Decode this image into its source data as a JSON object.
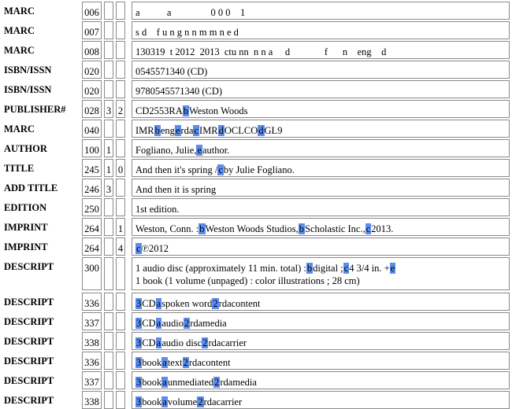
{
  "records": [
    {
      "label": "MARC",
      "tag": "006",
      "ind1": "",
      "ind2": "",
      "lines": [
        [
          "a           a                0 0 0    1"
        ]
      ]
    },
    {
      "label": "MARC",
      "tag": "007",
      "ind1": "",
      "ind2": "",
      "lines": [
        [
          "s d    f u n g n n m m n e d"
        ]
      ]
    },
    {
      "label": "MARC",
      "tag": "008",
      "ind1": "",
      "ind2": "",
      "lines": [
        [
          "130319  t 2012  2013  ctu nn  n n a     d              f      n    eng    d"
        ]
      ]
    },
    {
      "label": "ISBN/ISSN",
      "tag": "020",
      "ind1": "",
      "ind2": "",
      "lines": [
        [
          "0545571340 (CD)"
        ]
      ]
    },
    {
      "label": "ISBN/ISSN",
      "tag": "020",
      "ind1": "",
      "ind2": "",
      "lines": [
        [
          "9780545571340 (CD)"
        ]
      ]
    },
    {
      "label": "PUBLISHER#",
      "tag": "028",
      "ind1": "3",
      "ind2": "2",
      "lines": [
        [
          "CD2553RA",
          {
            "s": "b"
          },
          "Weston Woods"
        ]
      ]
    },
    {
      "label": "MARC",
      "tag": "040",
      "ind1": "",
      "ind2": "",
      "lines": [
        [
          "IMR",
          {
            "s": "b"
          },
          "eng",
          {
            "s": "e"
          },
          "rda",
          {
            "s": "c"
          },
          "IMR",
          {
            "s": "d"
          },
          "OCLCO",
          {
            "s": "d"
          },
          "GL9"
        ]
      ]
    },
    {
      "label": "AUTHOR",
      "tag": "100",
      "ind1": "1",
      "ind2": "",
      "lines": [
        [
          "Fogliano, Julie,",
          {
            "s": "e"
          },
          "author."
        ]
      ]
    },
    {
      "label": "TITLE",
      "tag": "245",
      "ind1": "1",
      "ind2": "0",
      "lines": [
        [
          "And then it's spring /",
          {
            "s": "c"
          },
          "by Julie Fogliano."
        ]
      ]
    },
    {
      "label": "ADD TITLE",
      "tag": "246",
      "ind1": "3",
      "ind2": "",
      "lines": [
        [
          "And then it is spring"
        ]
      ]
    },
    {
      "label": "EDITION",
      "tag": "250",
      "ind1": "",
      "ind2": "",
      "lines": [
        [
          "1st edition."
        ]
      ]
    },
    {
      "label": "IMPRINT",
      "tag": "264",
      "ind1": "",
      "ind2": "1",
      "lines": [
        [
          "Weston, Conn. :",
          {
            "s": "b"
          },
          "Weston Woods Studios,",
          {
            "s": "b"
          },
          "Scholastic Inc.,",
          {
            "s": "c"
          },
          "2013."
        ]
      ]
    },
    {
      "label": "IMPRINT",
      "tag": "264",
      "ind1": "",
      "ind2": "4",
      "lines": [
        [
          {
            "s": "c"
          },
          "℗2012"
        ]
      ]
    },
    {
      "label": "DESCRIPT",
      "tag": "300",
      "ind1": "",
      "ind2": "",
      "lines": [
        [
          "1 audio disc (approximately 11 min. total) :",
          {
            "s": "b"
          },
          "digital ;",
          {
            "s": "c"
          },
          "4 3/4 in. +",
          {
            "s": "e"
          }
        ],
        [
          "1 book (1 volume (unpaged) : color illustrations ; 28 cm)"
        ]
      ]
    },
    {
      "label": "DESCRIPT",
      "tag": "336",
      "ind1": "",
      "ind2": "",
      "lines": [
        [
          {
            "s": "3"
          },
          "CD",
          {
            "s": "a"
          },
          "spoken word",
          {
            "s": "2"
          },
          "rdacontent"
        ]
      ]
    },
    {
      "label": "DESCRIPT",
      "tag": "337",
      "ind1": "",
      "ind2": "",
      "lines": [
        [
          {
            "s": "3"
          },
          "CD",
          {
            "s": "a"
          },
          "audio",
          {
            "s": "2"
          },
          "rdamedia"
        ]
      ]
    },
    {
      "label": "DESCRIPT",
      "tag": "338",
      "ind1": "",
      "ind2": "",
      "lines": [
        [
          {
            "s": "3"
          },
          "CD",
          {
            "s": "a"
          },
          "audio disc",
          {
            "s": "2"
          },
          "rdacarrier"
        ]
      ]
    },
    {
      "label": "DESCRIPT",
      "tag": "336",
      "ind1": "",
      "ind2": "",
      "lines": [
        [
          {
            "s": "3"
          },
          "book",
          {
            "s": "a"
          },
          "text",
          {
            "s": "2"
          },
          "rdacontent"
        ]
      ]
    },
    {
      "label": "DESCRIPT",
      "tag": "337",
      "ind1": "",
      "ind2": "",
      "lines": [
        [
          {
            "s": "3"
          },
          "book",
          {
            "s": "a"
          },
          "unmediated",
          {
            "s": "2"
          },
          "rdamedia"
        ]
      ]
    },
    {
      "label": "DESCRIPT",
      "tag": "338",
      "ind1": "",
      "ind2": "",
      "lines": [
        [
          {
            "s": "3"
          },
          "book",
          {
            "s": "a"
          },
          "volume",
          {
            "s": "2"
          },
          "rdacarrier"
        ]
      ]
    }
  ],
  "colors": {
    "subfield_highlight": "#5b8ded",
    "field_border": "#8a8a8a"
  }
}
